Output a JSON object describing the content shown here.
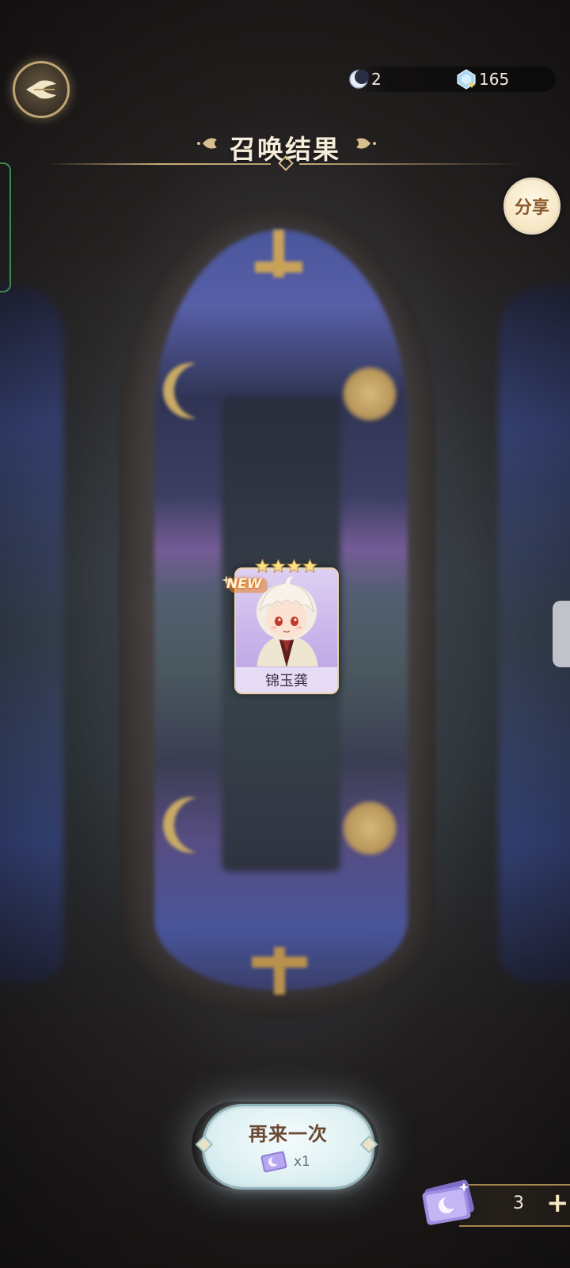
{
  "currency": {
    "moon_icon": "crescent-moon-icon",
    "moon_count": "2",
    "gem_icon": "crystal-gem-icon",
    "gem_count": "165"
  },
  "title": "召唤结果",
  "share_label": "分享",
  "result": {
    "badge": "NEW",
    "stars": 4,
    "character_name": "锦玉龚"
  },
  "retry": {
    "label": "再来一次",
    "cost": "x1"
  },
  "tickets": {
    "count": "3",
    "plus": "+"
  },
  "colors": {
    "gold_accent": "#c9ae78",
    "card_purple": "#c9b4ea",
    "retry_bg": "#e1f2f4",
    "title_text": "#f5ecd9"
  }
}
